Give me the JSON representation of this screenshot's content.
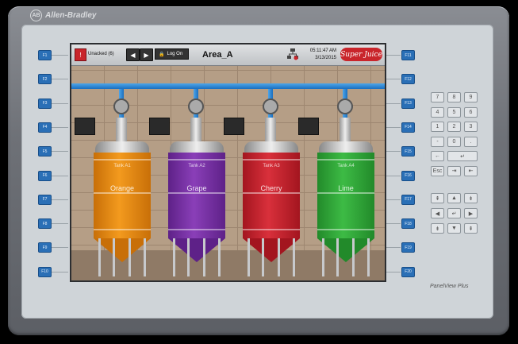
{
  "brand": {
    "logo_text": "Allen-Bradley",
    "model": "PanelView Plus"
  },
  "fkeys_left": [
    "F1",
    "F2",
    "F3",
    "F4",
    "F5",
    "F6",
    "F7",
    "F8",
    "F9",
    "F10"
  ],
  "fkeys_right": [
    "F11",
    "F12",
    "F13",
    "F14",
    "F15",
    "F16",
    "F17",
    "F18",
    "F19",
    "F20"
  ],
  "header": {
    "alarm_icon": "warning-icon",
    "unacked": "Unacked (6)",
    "back_icon": "arrow-left-icon",
    "forward_icon": "arrow-right-icon",
    "logon": "Log On",
    "area": "Area_A",
    "time": "05:11:47 AM",
    "date": "3/13/2015",
    "company": "Super Juice"
  },
  "tanks": [
    {
      "name": "Tank A1",
      "product": "Orange",
      "color": "#f39a1e",
      "dark": "#c86f08"
    },
    {
      "name": "Tank A2",
      "product": "Grape",
      "color": "#8a3fb8",
      "dark": "#5e2188"
    },
    {
      "name": "Tank A3",
      "product": "Cherry",
      "color": "#d9303b",
      "dark": "#a3151f"
    },
    {
      "name": "Tank A4",
      "product": "Lime",
      "color": "#3dbb45",
      "dark": "#228a2a"
    }
  ],
  "keypad": [
    [
      "7",
      "8",
      "9"
    ],
    [
      "4",
      "5",
      "6"
    ],
    [
      "1",
      "2",
      "3"
    ],
    [
      "-",
      "0",
      "."
    ],
    [
      "←",
      "↵",
      ""
    ],
    [
      "Esc",
      "⇥",
      "⇤"
    ]
  ],
  "nav_keys": [
    "⇞",
    "▲",
    "⇟",
    "◀",
    "↵",
    "▶",
    "⇟",
    "▼",
    "⇞"
  ]
}
